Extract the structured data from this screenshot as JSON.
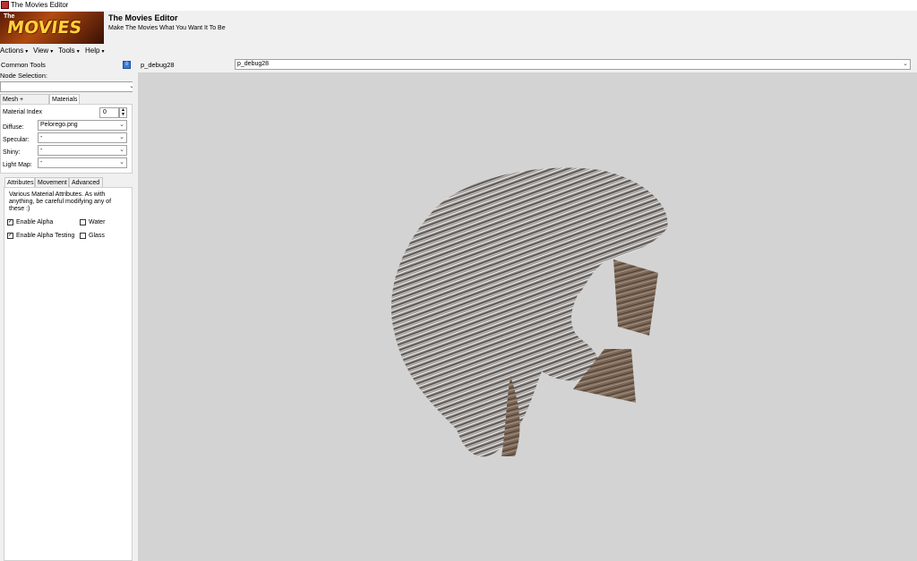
{
  "window": {
    "title": "The Movies Editor"
  },
  "banner": {
    "logo_text": "MOVIES",
    "logo_small": "The",
    "title": "The Movies Editor",
    "subtitle": "Make The Movies What You Want It To Be"
  },
  "menu": [
    "Actions",
    "View",
    "Tools",
    "Help"
  ],
  "left_panel": {
    "common_tools": "Common Tools",
    "node_selection_label": "Node Selection:",
    "node_selection_value": "",
    "tabs": [
      "Mesh + Textures",
      "Materials"
    ],
    "active_tab": "Materials",
    "material_index_label": "Material Index",
    "material_index_value": "0",
    "diffuse_label": "Diffuse:",
    "diffuse_value": "Pelorego.png",
    "specular_label": "Specular:",
    "specular_value": "-",
    "shiny_label": "Shiny:",
    "shiny_value": "-",
    "lightmap_label": "Light Map:",
    "lightmap_value": "-",
    "sub_tabs": [
      "Attributes",
      "Movement",
      "Advanced"
    ],
    "active_sub_tab": "Attributes",
    "description": "Various Material Attributes. As with anything, be careful modifying any of these :)",
    "checkboxes": [
      {
        "label": "Enable Alpha",
        "checked": true
      },
      {
        "label": "Water",
        "checked": false
      },
      {
        "label": "Enable Alpha Testing",
        "checked": true
      },
      {
        "label": "Glass",
        "checked": false
      }
    ]
  },
  "model_bar": {
    "label": "p_debug28",
    "selected": "p_debug28"
  },
  "colors": {
    "viewport": "#d3d3d3",
    "panel": "#f0f0f0"
  }
}
